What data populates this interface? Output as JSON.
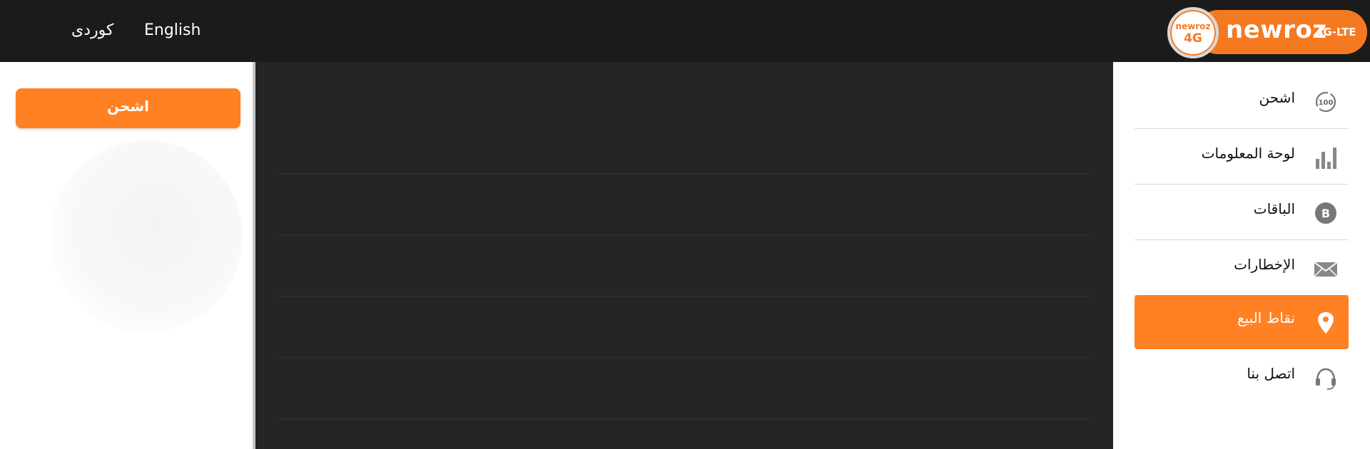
{
  "header": {
    "languages": [
      "كوردى",
      "English"
    ],
    "logo": {
      "wordmark": "newroz",
      "suffix": "4G-LTE",
      "badge_top": "newroz",
      "badge_bottom": "4G"
    }
  },
  "left_panel": {
    "recharge_label": "اشحن"
  },
  "sidebar": {
    "items": [
      {
        "label": "اشحن",
        "icon": "recharge-100-icon"
      },
      {
        "label": "لوحة المعلومات",
        "icon": "bar-chart-icon"
      },
      {
        "label": "الباقات",
        "icon": "bundle-b-icon"
      },
      {
        "label": "الإخطارات",
        "icon": "envelope-icon"
      },
      {
        "label": "نقاط البيع",
        "icon": "location-pin-icon"
      },
      {
        "label": "اتصل بنا",
        "icon": "headset-icon"
      }
    ],
    "active_index": 4
  },
  "colors": {
    "accent": "#ff8124",
    "topbar": "#1b1b1b",
    "content_bg": "#252525"
  }
}
